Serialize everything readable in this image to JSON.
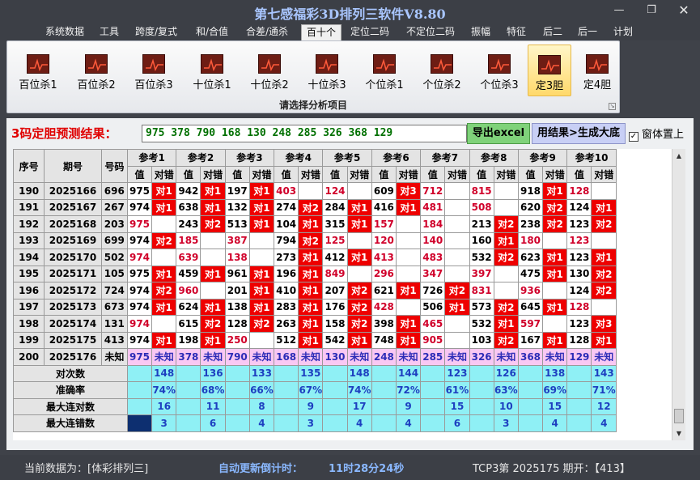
{
  "window": {
    "title": "第七感福彩3D排列三软件V8.80"
  },
  "menu": [
    "系统数据",
    "工具",
    "跨度/复式",
    "和/合值",
    "合差/通杀",
    "百十个",
    "定位二码",
    "不定位二码",
    "振幅",
    "特征",
    "后二",
    "后一",
    "计划"
  ],
  "ribbon": {
    "buttons": [
      "百位杀1",
      "百位杀2",
      "百位杀3",
      "十位杀1",
      "十位杀2",
      "十位杀3",
      "个位杀1",
      "个位杀2",
      "个位杀3",
      "定3胆",
      "定4胆"
    ],
    "selected_index": 9,
    "caption": "请选择分析项目"
  },
  "prediction": {
    "label": "3码定胆预测结果：",
    "value": "975 378 790 168 130 248 285 326 368 129",
    "export_label": "导出excel",
    "generate_label": "用结果>生成大底",
    "ontop_label": "窗体置上",
    "ontop_checked": "✓"
  },
  "table": {
    "headers": {
      "index": "序号",
      "period": "期号",
      "number": "号码",
      "ref_prefix": "参考",
      "value": "值",
      "hit": "对错"
    },
    "refs": [
      "1",
      "2",
      "3",
      "4",
      "5",
      "6",
      "7",
      "8",
      "9",
      "10"
    ],
    "rows": [
      {
        "i": "190",
        "p": "2025166",
        "n": "696",
        "c": [
          [
            "975",
            1,
            "对1"
          ],
          [
            "942",
            1,
            "对1"
          ],
          [
            "197",
            1,
            "对1"
          ],
          [
            "403",
            0,
            ""
          ],
          [
            "124",
            0,
            ""
          ],
          [
            "609",
            1,
            "对3"
          ],
          [
            "712",
            0,
            ""
          ],
          [
            "815",
            0,
            ""
          ],
          [
            "918",
            1,
            "对1"
          ],
          [
            "128",
            0,
            ""
          ]
        ]
      },
      {
        "i": "191",
        "p": "2025167",
        "n": "267",
        "c": [
          [
            "974",
            1,
            "对1"
          ],
          [
            "638",
            1,
            "对1"
          ],
          [
            "132",
            1,
            "对1"
          ],
          [
            "274",
            1,
            "对2"
          ],
          [
            "284",
            1,
            "对1"
          ],
          [
            "416",
            1,
            "对1"
          ],
          [
            "481",
            0,
            ""
          ],
          [
            "508",
            0,
            ""
          ],
          [
            "620",
            1,
            "对2"
          ],
          [
            "124",
            1,
            "对1"
          ]
        ]
      },
      {
        "i": "192",
        "p": "2025168",
        "n": "203",
        "c": [
          [
            "975",
            0,
            ""
          ],
          [
            "243",
            1,
            "对2"
          ],
          [
            "513",
            1,
            "对1"
          ],
          [
            "104",
            1,
            "对1"
          ],
          [
            "315",
            1,
            "对1"
          ],
          [
            "157",
            0,
            ""
          ],
          [
            "184",
            0,
            ""
          ],
          [
            "213",
            1,
            "对2"
          ],
          [
            "238",
            1,
            "对2"
          ],
          [
            "123",
            1,
            "对2"
          ]
        ]
      },
      {
        "i": "193",
        "p": "2025169",
        "n": "699",
        "c": [
          [
            "974",
            1,
            "对2"
          ],
          [
            "185",
            0,
            ""
          ],
          [
            "387",
            0,
            ""
          ],
          [
            "794",
            1,
            "对2"
          ],
          [
            "125",
            0,
            ""
          ],
          [
            "120",
            0,
            ""
          ],
          [
            "140",
            0,
            ""
          ],
          [
            "160",
            1,
            "对1"
          ],
          [
            "180",
            0,
            ""
          ],
          [
            "123",
            0,
            ""
          ]
        ]
      },
      {
        "i": "194",
        "p": "2025170",
        "n": "502",
        "c": [
          [
            "974",
            0,
            ""
          ],
          [
            "639",
            0,
            ""
          ],
          [
            "138",
            0,
            ""
          ],
          [
            "273",
            1,
            "对1"
          ],
          [
            "412",
            1,
            "对1"
          ],
          [
            "413",
            0,
            ""
          ],
          [
            "483",
            0,
            ""
          ],
          [
            "532",
            1,
            "对2"
          ],
          [
            "623",
            1,
            "对1"
          ],
          [
            "123",
            1,
            "对1"
          ]
        ]
      },
      {
        "i": "195",
        "p": "2025171",
        "n": "105",
        "c": [
          [
            "975",
            1,
            "对1"
          ],
          [
            "459",
            1,
            "对1"
          ],
          [
            "961",
            1,
            "对1"
          ],
          [
            "196",
            1,
            "对1"
          ],
          [
            "849",
            0,
            ""
          ],
          [
            "296",
            0,
            ""
          ],
          [
            "347",
            0,
            ""
          ],
          [
            "397",
            0,
            ""
          ],
          [
            "475",
            1,
            "对1"
          ],
          [
            "130",
            1,
            "对2"
          ]
        ]
      },
      {
        "i": "196",
        "p": "2025172",
        "n": "724",
        "c": [
          [
            "974",
            1,
            "对2"
          ],
          [
            "960",
            0,
            ""
          ],
          [
            "201",
            1,
            "对1"
          ],
          [
            "410",
            1,
            "对1"
          ],
          [
            "207",
            1,
            "对2"
          ],
          [
            "621",
            1,
            "对1"
          ],
          [
            "726",
            1,
            "对2"
          ],
          [
            "831",
            0,
            ""
          ],
          [
            "936",
            0,
            ""
          ],
          [
            "124",
            1,
            "对2"
          ]
        ]
      },
      {
        "i": "197",
        "p": "2025173",
        "n": "673",
        "c": [
          [
            "974",
            1,
            "对1"
          ],
          [
            "624",
            1,
            "对1"
          ],
          [
            "138",
            1,
            "对1"
          ],
          [
            "283",
            1,
            "对1"
          ],
          [
            "176",
            1,
            "对2"
          ],
          [
            "428",
            0,
            ""
          ],
          [
            "506",
            1,
            "对1"
          ],
          [
            "573",
            1,
            "对2"
          ],
          [
            "645",
            1,
            "对1"
          ],
          [
            "128",
            0,
            ""
          ]
        ]
      },
      {
        "i": "198",
        "p": "2025174",
        "n": "131",
        "c": [
          [
            "974",
            0,
            ""
          ],
          [
            "615",
            1,
            "对2"
          ],
          [
            "128",
            1,
            "对2"
          ],
          [
            "263",
            1,
            "对1"
          ],
          [
            "158",
            1,
            "对2"
          ],
          [
            "398",
            1,
            "对1"
          ],
          [
            "465",
            0,
            ""
          ],
          [
            "532",
            1,
            "对1"
          ],
          [
            "597",
            0,
            ""
          ],
          [
            "123",
            1,
            "对3"
          ]
        ]
      },
      {
        "i": "199",
        "p": "2025175",
        "n": "413",
        "c": [
          [
            "974",
            1,
            "对1"
          ],
          [
            "198",
            1,
            "对1"
          ],
          [
            "250",
            0,
            ""
          ],
          [
            "512",
            1,
            "对1"
          ],
          [
            "542",
            1,
            "对1"
          ],
          [
            "748",
            1,
            "对1"
          ],
          [
            "905",
            0,
            ""
          ],
          [
            "103",
            1,
            "对2"
          ],
          [
            "167",
            1,
            "对1"
          ],
          [
            "128",
            1,
            "对1"
          ]
        ]
      }
    ],
    "pending": {
      "i": "200",
      "p": "2025176",
      "n": "未知",
      "values": [
        "975",
        "378",
        "790",
        "168",
        "130",
        "248",
        "285",
        "326",
        "368",
        "129"
      ],
      "hit": "未知"
    },
    "stats": [
      {
        "label": "对次数",
        "values": [
          "148",
          "136",
          "133",
          "135",
          "148",
          "144",
          "123",
          "126",
          "138",
          "143"
        ]
      },
      {
        "label": "准确率",
        "values": [
          "74%",
          "68%",
          "66%",
          "67%",
          "74%",
          "72%",
          "61%",
          "63%",
          "69%",
          "71%"
        ]
      },
      {
        "label": "最大连对数",
        "values": [
          "16",
          "11",
          "8",
          "9",
          "17",
          "9",
          "15",
          "10",
          "15",
          "12"
        ]
      },
      {
        "label": "最大连错数",
        "values": [
          "3",
          "6",
          "4",
          "3",
          "4",
          "4",
          "6",
          "3",
          "4",
          "4"
        ]
      }
    ]
  },
  "status": {
    "current_data": "当前数据为：[体彩排列三]",
    "countdown_label": "自动更新倒计时：",
    "countdown": "11时28分24秒",
    "draw_info": "TCP3第 2025175 期开：【413】"
  },
  "icons": {
    "minimize": "minimize-icon",
    "restore": "restore-icon",
    "close": "close-icon"
  }
}
